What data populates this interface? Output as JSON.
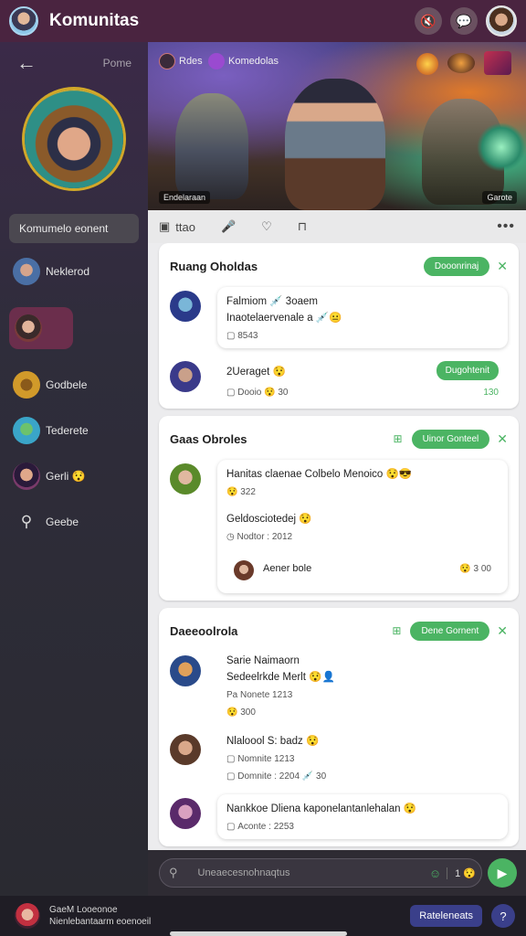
{
  "app": {
    "title": "Komunitas"
  },
  "topbar": {
    "icons": [
      "mute-icon",
      "chat-icon"
    ]
  },
  "sidebar": {
    "back_label": "Pome",
    "community_name": "Komumelo eonent",
    "items": [
      {
        "label": "Neklerod",
        "color": "#4a6fa5"
      },
      {
        "label": "",
        "color": "#7a3a3a"
      },
      {
        "label": "Godbele",
        "color": "#d19a2a"
      },
      {
        "label": "Tederete",
        "color": "#3aa5c8"
      },
      {
        "label": "Gerli 😯",
        "color": "#7a3a6a"
      },
      {
        "label": "Geebe",
        "color": ""
      }
    ]
  },
  "banner": {
    "tag_left": "Rdes",
    "tag_mid": "Komedolas",
    "caption_left": "Endelaraan",
    "caption_right": "Garote"
  },
  "actionbar": {
    "items": [
      "ttao",
      "",
      "",
      ""
    ],
    "more": "•••"
  },
  "feed": {
    "cards": [
      {
        "title": "Ruang Oholdas",
        "pill": "Dooonrinaj",
        "messages": [
          {
            "title": "Falmiom 💉 3oaem",
            "sub": "Inaotelaervenale a 💉😐",
            "meta": "8543",
            "meta_right": ""
          },
          {
            "title": "2Ueraget 😯",
            "sub": "",
            "meta": "Dooio 😯 30",
            "meta_right": "130",
            "pill": "Dugohtenit"
          }
        ]
      },
      {
        "title": "Gaas Obroles",
        "pill": "Uinor Gonteel",
        "messages": [
          {
            "title": "Hanitas claenae Colbelo Menoico 😯😎",
            "sub": "",
            "meta": "😯 322",
            "meta_right": ""
          },
          {
            "title": "Geldosciotedej 😯",
            "sub": "",
            "meta": "Nodtor : 2012",
            "meta_right": ""
          }
        ],
        "reply": {
          "label": "Aener bole",
          "count": "😯 3 00"
        }
      },
      {
        "title": "Daeeoolrola",
        "pill": "Dene Gornent",
        "messages": [
          {
            "title": "Sarie Naimaorn",
            "sub": "Sedeelrkde Merlt 😯👤",
            "meta": "Pa Nonete 1213",
            "meta2": "😯 300"
          },
          {
            "title": "Nlaloool S: badz 😯",
            "sub": "",
            "meta": "Nomnite 1213",
            "meta2": "Domnite : 2204 💉 30"
          },
          {
            "title": "Nankkoe Dliena kaponelantanlehalan 😯",
            "sub": "",
            "meta": "Aconte : 2253"
          }
        ]
      }
    ]
  },
  "input": {
    "placeholder": "Uneaecesnohnaqtus",
    "count": "1 😯"
  },
  "bottombar": {
    "line1": "GaeM Looeonoe",
    "line2": "Nienlebantaarm eoenoeil",
    "button": "Rateleneats"
  },
  "colors": {
    "accent": "#4bb463",
    "topbar": "#4a2440",
    "nav": "#3a3f8a"
  }
}
